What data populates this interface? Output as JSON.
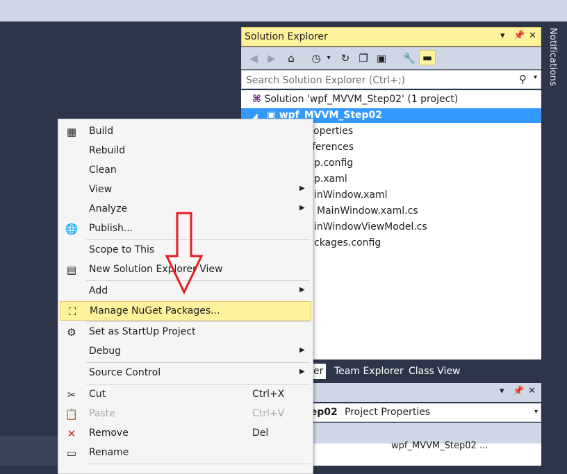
{
  "notifications": {
    "label": "Notifications"
  },
  "solution_explorer": {
    "title": "Solution Explorer",
    "search_placeholder": "Search Solution Explorer (Ctrl+;)",
    "tree": [
      {
        "label": "Solution 'wpf_MVVM_Step02' (1 project)"
      },
      {
        "label": "wpf_MVVM_Step02",
        "selected": true
      },
      {
        "label": "operties"
      },
      {
        "label": "ferences"
      },
      {
        "label": "p.config"
      },
      {
        "label": "p.xaml"
      },
      {
        "label": "inWindow.xaml"
      },
      {
        "label": "MainWindow.xaml.cs"
      },
      {
        "label": "inWindowViewModel.cs"
      },
      {
        "label": "ckages.config"
      }
    ],
    "tabs": [
      "er",
      "Team Explorer",
      "Class View"
    ]
  },
  "properties": {
    "object_name": "tep02",
    "object_type": "Project Properties",
    "row_fragment": "wpf_MVVM_Step02 ..."
  },
  "context_menu": {
    "items": [
      {
        "label": "Build",
        "icon": "build-icon"
      },
      {
        "label": "Rebuild"
      },
      {
        "label": "Clean"
      },
      {
        "label": "View",
        "submenu": true
      },
      {
        "label": "Analyze",
        "submenu": true
      },
      {
        "label": "Publish...",
        "icon": "globe-icon"
      },
      {
        "label": "Scope to This"
      },
      {
        "label": "New Solution Explorer View",
        "icon": "new-window-icon"
      },
      {
        "label": "Add",
        "submenu": true
      },
      {
        "label": "Manage NuGet Packages...",
        "icon": "nuget-icon",
        "highlighted": true
      },
      {
        "label": "Set as StartUp Project",
        "icon": "gear-icon"
      },
      {
        "label": "Debug",
        "submenu": true
      },
      {
        "label": "Source Control",
        "submenu": true
      },
      {
        "label": "Cut",
        "shortcut": "Ctrl+X",
        "icon": "scissors-icon"
      },
      {
        "label": "Paste",
        "shortcut": "Ctrl+V",
        "icon": "paste-icon",
        "disabled": true
      },
      {
        "label": "Remove",
        "shortcut": "Del",
        "icon": "remove-icon"
      },
      {
        "label": "Rename",
        "icon": "rename-icon"
      }
    ]
  },
  "colors": {
    "highlight": "#fff29d",
    "selection": "#3399ff",
    "annotation_arrow": "#e51c23",
    "background": "#2d3649"
  }
}
